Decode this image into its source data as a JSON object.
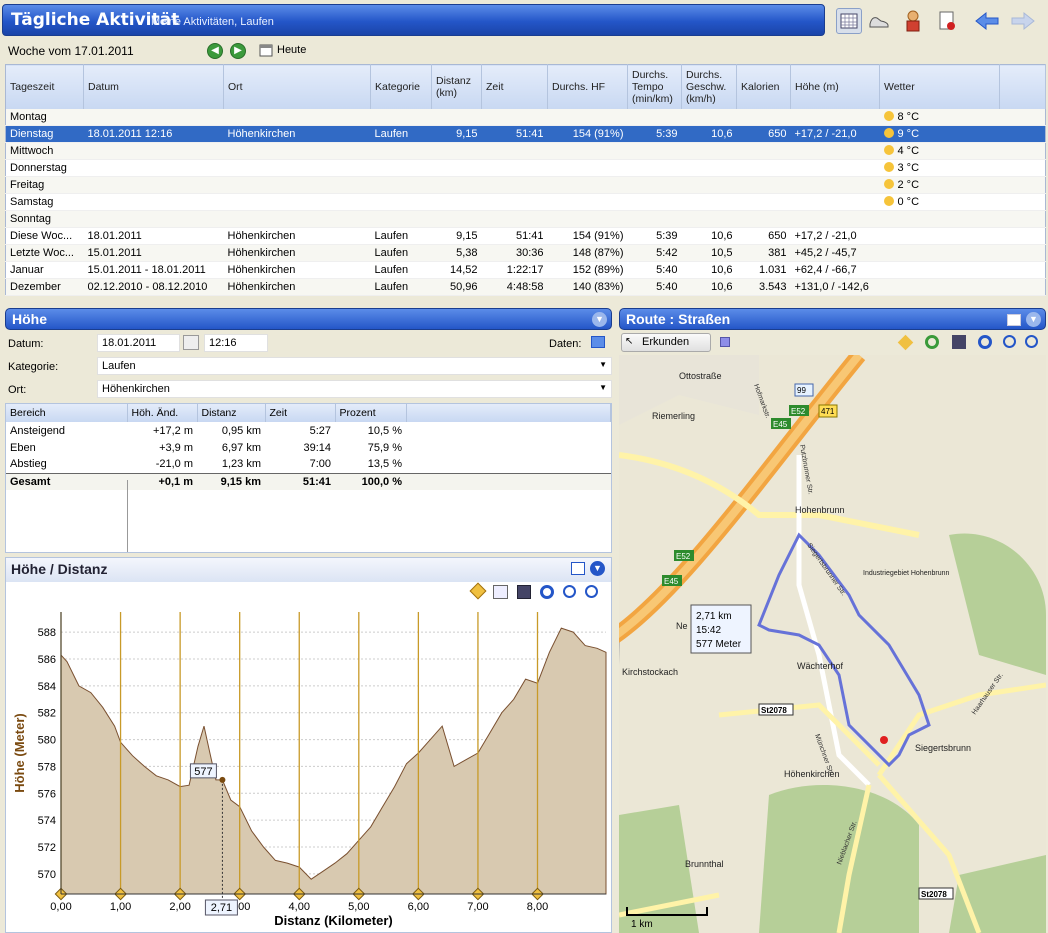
{
  "header": {
    "title": "Tägliche Aktivität",
    "crumb": "Meine Aktivitäten, Laufen"
  },
  "week": {
    "label": "Woche vom 17.01.2011",
    "today": "Heute"
  },
  "grid": {
    "columns": [
      "Tageszeit",
      "Datum",
      "Ort",
      "Kategorie",
      "Distanz (km)",
      "Zeit",
      "Durchs. HF",
      "Durchs. Tempo (min/km)",
      "Durchs. Geschw. (km/h)",
      "Kalorien",
      "Höhe (m)",
      "Wetter"
    ],
    "days": [
      {
        "name": "Montag",
        "weather": "8 °C"
      },
      {
        "name": "Dienstag",
        "datum": "18.01.2011 12:16",
        "ort": "Höhenkirchen",
        "kat": "Laufen",
        "dist": "9,15",
        "zeit": "51:41",
        "hf": "154 (91%)",
        "tempo": "5:39",
        "gesch": "10,6",
        "kal": "650",
        "hoehe": "+17,2 / -21,0",
        "weather": "9 °C"
      },
      {
        "name": "Mittwoch",
        "weather": "4 °C"
      },
      {
        "name": "Donnerstag",
        "weather": "3 °C"
      },
      {
        "name": "Freitag",
        "weather": "2 °C"
      },
      {
        "name": "Samstag",
        "weather": "0 °C"
      },
      {
        "name": "Sonntag",
        "weather": ""
      }
    ],
    "summary": [
      {
        "name": "Diese Woc...",
        "datum": "18.01.2011",
        "ort": "Höhenkirchen",
        "kat": "Laufen",
        "dist": "9,15",
        "zeit": "51:41",
        "hf": "154 (91%)",
        "tempo": "5:39",
        "gesch": "10,6",
        "kal": "650",
        "hoehe": "+17,2 / -21,0"
      },
      {
        "name": "Letzte Woc...",
        "datum": "15.01.2011",
        "ort": "Höhenkirchen",
        "kat": "Laufen",
        "dist": "5,38",
        "zeit": "30:36",
        "hf": "148 (87%)",
        "tempo": "5:42",
        "gesch": "10,5",
        "kal": "381",
        "hoehe": "+45,2 / -45,7"
      },
      {
        "name": "Januar",
        "datum": "15.01.2011 - 18.01.2011",
        "ort": "Höhenkirchen",
        "kat": "Laufen",
        "dist": "14,52",
        "zeit": "1:22:17",
        "hf": "152 (89%)",
        "tempo": "5:40",
        "gesch": "10,6",
        "kal": "1.031",
        "hoehe": "+62,4 / -66,7"
      },
      {
        "name": "Dezember",
        "datum": "02.12.2010 - 08.12.2010",
        "ort": "Höhenkirchen",
        "kat": "Laufen",
        "dist": "50,96",
        "zeit": "4:48:58",
        "hf": "140 (83%)",
        "tempo": "5:40",
        "gesch": "10,6",
        "kal": "3.543",
        "hoehe": "+131,0 / -142,6"
      }
    ]
  },
  "hoehe": {
    "title": "Höhe",
    "datum_label": "Datum:",
    "datum": "18.01.2011",
    "zeit": "12:16",
    "daten": "Daten:",
    "kat_label": "Kategorie:",
    "kat": "Laufen",
    "ort_label": "Ort:",
    "ort": "Höhenkirchen",
    "cols": [
      "Bereich",
      "Höh. Änd.",
      "Distanz",
      "Zeit",
      "Prozent"
    ],
    "rows": [
      [
        "Ansteigend",
        "+17,2 m",
        "0,95 km",
        "5:27",
        "10,5 %"
      ],
      [
        "Eben",
        "+3,9 m",
        "6,97 km",
        "39:14",
        "75,9 %"
      ],
      [
        "Abstieg",
        "-21,0 m",
        "1,23 km",
        "7:00",
        "13,5 %"
      ]
    ],
    "total": [
      "Gesamt",
      "+0,1 m",
      "9,15 km",
      "51:41",
      "100,0 %"
    ]
  },
  "route": {
    "title": "Route : Straßen",
    "explore": "Erkunden",
    "places": [
      "Riemerling",
      "Ottostraße",
      "Putzbrunner Str.",
      "Hohenbrunn",
      "Industriegebiet Hohenbrunn",
      "Siegertsbrunner Str.",
      "Wächterhof",
      "Höhenkirchen",
      "Siegertsbrunn",
      "Kirchstockach",
      "Brunnthal",
      "Münchner Str.",
      "Nieblacher Str.",
      "Hofmarkstr.",
      "Haarhauser Str.",
      "Ne"
    ],
    "roads": [
      "E52",
      "E45",
      "471",
      "99",
      "St2078",
      "E52",
      "E45",
      "St2078"
    ],
    "tooltip": [
      "2,71 km",
      "15:42",
      "577 Meter"
    ],
    "scale": "1 km"
  },
  "chart_data": {
    "type": "area",
    "title": "Höhe / Distanz",
    "xlabel": "Distanz (Kilometer)",
    "ylabel": "Höhe (Meter)",
    "xlim": [
      0,
      9.15
    ],
    "ylim": [
      568.5,
      589.5
    ],
    "xticks": [
      "0,00",
      "1,00",
      "2,00",
      "3,00",
      "4,00",
      "5,00",
      "6,00",
      "7,00",
      "8,00"
    ],
    "yticks": [
      "570",
      "572",
      "574",
      "576",
      "578",
      "580",
      "582",
      "584",
      "586",
      "588"
    ],
    "x": [
      0,
      0.1,
      0.3,
      0.5,
      0.7,
      0.9,
      1.0,
      1.2,
      1.4,
      1.6,
      1.8,
      2.0,
      2.15,
      2.3,
      2.4,
      2.5,
      2.6,
      2.71,
      2.85,
      3.0,
      3.2,
      3.4,
      3.6,
      3.8,
      4.0,
      4.2,
      4.4,
      4.6,
      4.8,
      5.0,
      5.2,
      5.4,
      5.6,
      5.8,
      6.0,
      6.2,
      6.4,
      6.6,
      6.8,
      7.0,
      7.2,
      7.4,
      7.6,
      7.8,
      8.0,
      8.2,
      8.4,
      8.6,
      8.8,
      9.0,
      9.15
    ],
    "y": [
      586.3,
      585.8,
      584.0,
      583.5,
      582.4,
      581.0,
      579.8,
      578.8,
      578.0,
      577.3,
      577.0,
      576.5,
      576.6,
      579.5,
      581.0,
      579.0,
      577.0,
      577.0,
      575.5,
      575.0,
      573.2,
      572.0,
      571.0,
      570.8,
      570.5,
      569.6,
      570.2,
      570.8,
      571.5,
      572.5,
      573.5,
      575.0,
      576.5,
      578.2,
      579.0,
      580.0,
      581.0,
      578.0,
      578.5,
      579.0,
      580.5,
      582.0,
      583.0,
      584.5,
      584.2,
      586.5,
      588.3,
      588.0,
      587.0,
      586.8,
      586.5
    ],
    "cursor": {
      "x": 2.71,
      "y": 577,
      "label": "577",
      "xlabel": "2,71"
    },
    "grid": true
  }
}
